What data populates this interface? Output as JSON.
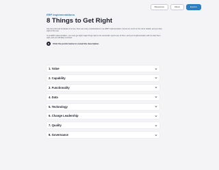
{
  "nav": {
    "buttons": [
      {
        "label": "Resources"
      },
      {
        "label": "About"
      },
      {
        "label": "Explore"
      }
    ],
    "accent_color": "#2f7fbf"
  },
  "header": {
    "eyebrow": "ERP Implementations",
    "title": "8 Things to Get Right",
    "intro_1": "Use the tools and templates of a tree, there are many considerations in an ERP implementation. Focus too much on the minor details, and you lose sight of the tree.",
    "intro_2": "In an ERP implementation, you must get eight major things right to be successful. Ignore any of them, and your implementation will not start them right, and you will likely succeed.",
    "instruction": "Click the points below to reveal the description."
  },
  "accordion": {
    "items": [
      {
        "label": "1. Value"
      },
      {
        "label": "2. Capability"
      },
      {
        "label": "3. Functionality"
      },
      {
        "label": "4. Data"
      },
      {
        "label": "5. Technology"
      },
      {
        "label": "6. Change Leadership"
      },
      {
        "label": "7. Quality"
      },
      {
        "label": "8. Governance"
      }
    ],
    "icon": "chevron-down-icon"
  }
}
